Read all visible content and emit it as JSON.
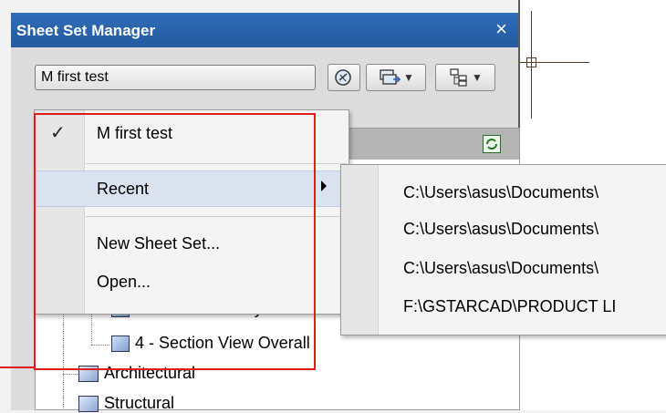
{
  "palette": {
    "title": "Sheet Set Manager",
    "close_glyph": "×",
    "combo_value": "M first test"
  },
  "menu": {
    "check_glyph": "✓",
    "items": [
      {
        "label": "M first test"
      },
      {
        "label": "Recent"
      },
      {
        "label": "New Sheet Set..."
      },
      {
        "label": "Open..."
      }
    ]
  },
  "submenu": {
    "items": [
      {
        "label": "C:\\Users\\asus\\Documents\\"
      },
      {
        "label": "C:\\Users\\asus\\Documents\\"
      },
      {
        "label": "C:\\Users\\asus\\Documents\\"
      },
      {
        "label": "F:\\GSTARCAD\\PRODUCT LI"
      }
    ]
  },
  "tree": {
    "items": [
      {
        "label": "2 - Plan View Layout"
      },
      {
        "label": "4 - Section View Overall"
      },
      {
        "label": "Architectural"
      },
      {
        "label": "Structural"
      }
    ]
  },
  "icons": {
    "close": "close-icon",
    "dropdown": "chevron-down-icon",
    "publish": "publish-icon",
    "refresh": "refresh-icon"
  }
}
